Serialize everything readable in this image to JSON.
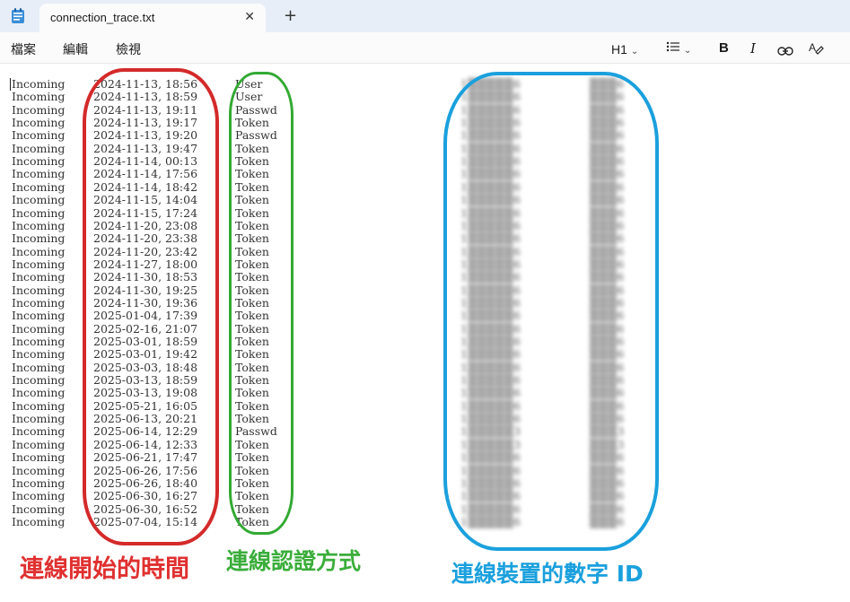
{
  "window": {
    "tab_title": "connection_trace.txt",
    "close_glyph": "✕",
    "new_tab_glyph": "+",
    "app_icon": "notepad-icon"
  },
  "menu": {
    "file": "檔案",
    "edit": "編輯",
    "view": "檢視"
  },
  "toolbar": {
    "heading": "H1",
    "bold": "B",
    "italic": "I",
    "list_icon": "list-icon",
    "link_icon": "link-icon",
    "clear_format_icon": "clear-format-icon"
  },
  "log": {
    "rows": [
      {
        "dir": "Incoming",
        "time": "2024-11-13, 18:56",
        "auth": "User",
        "id1": "1▒▒▒▒▒6",
        "id2": "▒▒▒6"
      },
      {
        "dir": "Incoming",
        "time": "2024-11-13, 18:59",
        "auth": "User",
        "id1": "1▒▒▒▒▒6",
        "id2": "▒▒▒6"
      },
      {
        "dir": "Incoming",
        "time": "2024-11-13, 19:11",
        "auth": "Passwd",
        "id1": "1▒▒▒▒▒6",
        "id2": "▒▒▒6"
      },
      {
        "dir": "Incoming",
        "time": "2024-11-13, 19:17",
        "auth": "Token",
        "id1": "1▒▒▒▒▒6",
        "id2": "▒▒▒6"
      },
      {
        "dir": "Incoming",
        "time": "2024-11-13, 19:20",
        "auth": "Passwd",
        "id1": "1▒▒▒▒▒6",
        "id2": "▒▒▒6"
      },
      {
        "dir": "Incoming",
        "time": "2024-11-13, 19:47",
        "auth": "Token",
        "id1": "1▒▒▒▒▒6",
        "id2": "▒▒▒6"
      },
      {
        "dir": "Incoming",
        "time": "2024-11-14, 00:13",
        "auth": "Token",
        "id1": "1▒▒▒▒▒6",
        "id2": "▒▒▒6"
      },
      {
        "dir": "Incoming",
        "time": "2024-11-14, 17:56",
        "auth": "Token",
        "id1": "1▒▒▒▒▒6",
        "id2": "▒▒▒6"
      },
      {
        "dir": "Incoming",
        "time": "2024-11-14, 18:42",
        "auth": "Token",
        "id1": "1▒▒▒▒▒6",
        "id2": "▒▒▒6"
      },
      {
        "dir": "Incoming",
        "time": "2024-11-15, 14:04",
        "auth": "Token",
        "id1": "1▒▒▒▒▒6",
        "id2": "▒▒▒6"
      },
      {
        "dir": "Incoming",
        "time": "2024-11-15, 17:24",
        "auth": "Token",
        "id1": "1▒▒▒▒▒6",
        "id2": "▒▒▒6"
      },
      {
        "dir": "Incoming",
        "time": "2024-11-20, 23:08",
        "auth": "Token",
        "id1": "1▒▒▒▒▒6",
        "id2": "▒▒▒6"
      },
      {
        "dir": "Incoming",
        "time": "2024-11-20, 23:38",
        "auth": "Token",
        "id1": "1▒▒▒▒▒6",
        "id2": "▒▒▒6"
      },
      {
        "dir": "Incoming",
        "time": "2024-11-20, 23:42",
        "auth": "Token",
        "id1": "1▒▒▒▒▒6",
        "id2": "▒▒▒6"
      },
      {
        "dir": "Incoming",
        "time": "2024-11-27, 18:00",
        "auth": "Token",
        "id1": "1▒▒▒▒▒6",
        "id2": "▒▒▒6"
      },
      {
        "dir": "Incoming",
        "time": "2024-11-30, 18:53",
        "auth": "Token",
        "id1": "1▒▒▒▒▒6",
        "id2": "▒▒▒6"
      },
      {
        "dir": "Incoming",
        "time": "2024-11-30, 19:25",
        "auth": "Token",
        "id1": "1▒▒▒▒▒6",
        "id2": "▒▒▒6"
      },
      {
        "dir": "Incoming",
        "time": "2024-11-30, 19:36",
        "auth": "Token",
        "id1": "1▒▒▒▒▒6",
        "id2": "▒▒▒6"
      },
      {
        "dir": "Incoming",
        "time": "2025-01-04, 17:39",
        "auth": "Token",
        "id1": "1▒▒▒▒▒6",
        "id2": "▒▒▒6"
      },
      {
        "dir": "Incoming",
        "time": "2025-02-16, 21:07",
        "auth": "Token",
        "id1": "1▒▒▒▒▒6",
        "id2": "▒▒▒6"
      },
      {
        "dir": "Incoming",
        "time": "2025-03-01, 18:59",
        "auth": "Token",
        "id1": "1▒▒▒▒▒6",
        "id2": "▒▒▒6"
      },
      {
        "dir": "Incoming",
        "time": "2025-03-01, 19:42",
        "auth": "Token",
        "id1": "1▒▒▒▒▒6",
        "id2": "▒▒▒6"
      },
      {
        "dir": "Incoming",
        "time": "2025-03-03, 18:48",
        "auth": "Token",
        "id1": "1▒▒▒▒▒6",
        "id2": "▒▒▒6"
      },
      {
        "dir": "Incoming",
        "time": "2025-03-13, 18:59",
        "auth": "Token",
        "id1": "1▒▒▒▒▒6",
        "id2": "▒▒▒6"
      },
      {
        "dir": "Incoming",
        "time": "2025-03-13, 19:08",
        "auth": "Token",
        "id1": "1▒▒▒▒▒6",
        "id2": "▒▒▒6"
      },
      {
        "dir": "Incoming",
        "time": "2025-05-21, 16:05",
        "auth": "Token",
        "id1": "1▒▒▒▒▒6",
        "id2": "▒▒▒6"
      },
      {
        "dir": "Incoming",
        "time": "2025-06-13, 20:21",
        "auth": "Token",
        "id1": "1▒▒▒▒▒6",
        "id2": "▒▒▒6"
      },
      {
        "dir": "Incoming",
        "time": "2025-06-14, 12:29",
        "auth": "Passwd",
        "id1": "1▒▒▒▒▒3",
        "id2": "▒▒▒3"
      },
      {
        "dir": "Incoming",
        "time": "2025-06-14, 12:33",
        "auth": "Token",
        "id1": "1▒▒▒▒▒3",
        "id2": "▒▒▒3"
      },
      {
        "dir": "Incoming",
        "time": "2025-06-21, 17:47",
        "auth": "Token",
        "id1": "1▒▒▒▒▒6",
        "id2": "▒▒▒6"
      },
      {
        "dir": "Incoming",
        "time": "2025-06-26, 17:56",
        "auth": "Token",
        "id1": "1▒▒▒▒▒6",
        "id2": "▒▒▒6"
      },
      {
        "dir": "Incoming",
        "time": "2025-06-26, 18:40",
        "auth": "Token",
        "id1": "1▒▒▒▒▒6",
        "id2": "▒▒▒6"
      },
      {
        "dir": "Incoming",
        "time": "2025-06-30, 16:27",
        "auth": "Token",
        "id1": "1▒▒▒▒▒6",
        "id2": "▒▒▒6"
      },
      {
        "dir": "Incoming",
        "time": "2025-06-30, 16:52",
        "auth": "Token",
        "id1": "1▒▒▒▒▒6",
        "id2": "▒▒▒6"
      },
      {
        "dir": "Incoming",
        "time": "2025-07-04, 15:14",
        "auth": "Token",
        "id1": "1▒▒▒▒▒6",
        "id2": "▒▒▒6"
      }
    ]
  },
  "annotations": {
    "time_caption": "連線開始的時間",
    "auth_caption": "連線認證方式",
    "id_caption": "連線裝置的數字 ID",
    "colors": {
      "red": "#d42a2a",
      "green": "#33a933",
      "blue": "#1ba0dd"
    }
  }
}
